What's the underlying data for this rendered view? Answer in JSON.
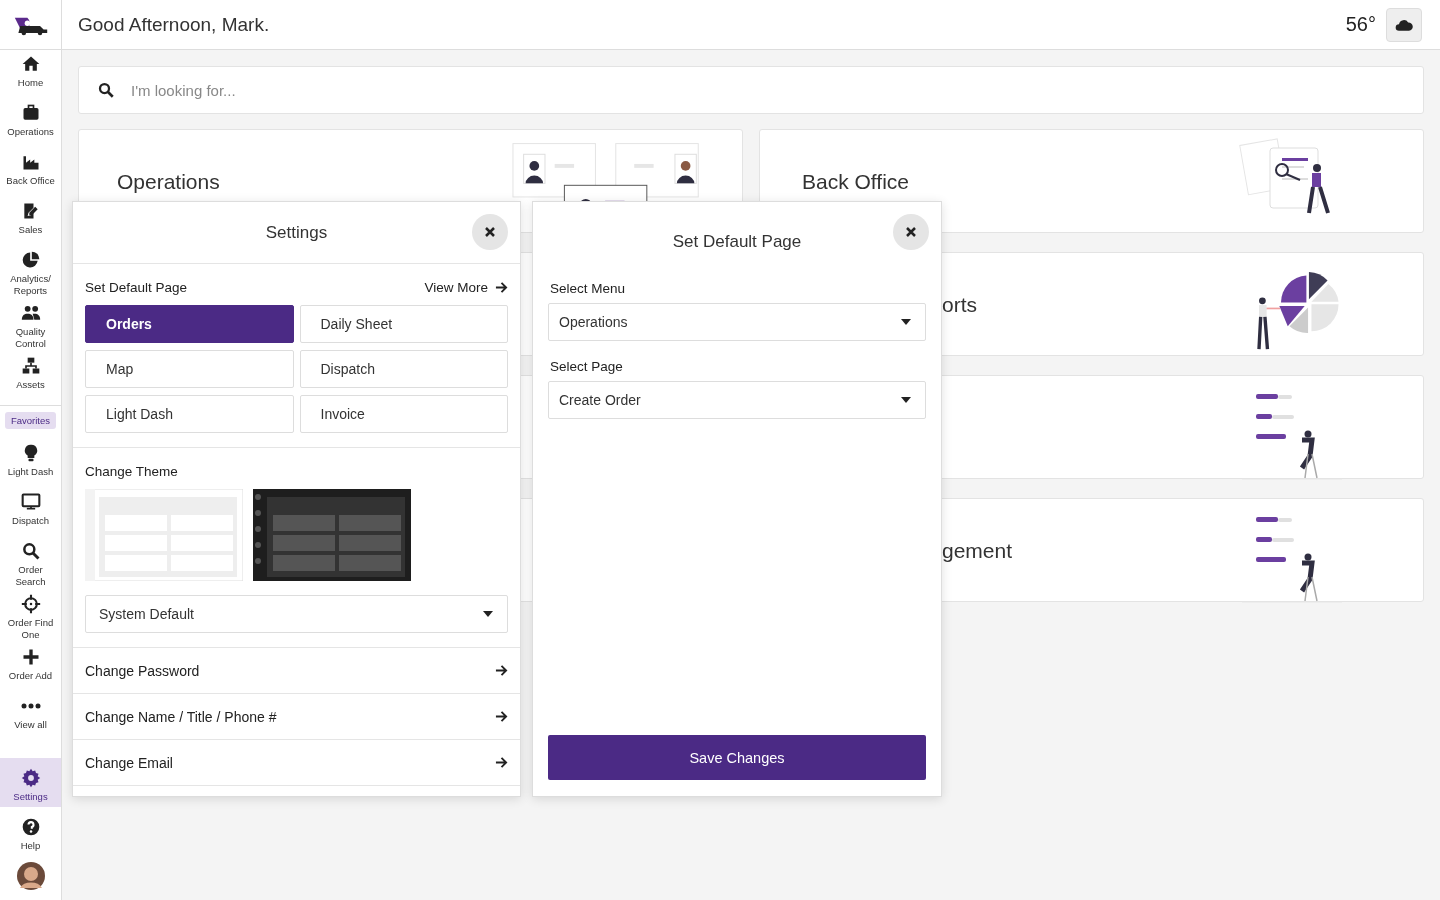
{
  "header": {
    "greeting": "Good Afternoon, Mark.",
    "temperature": "56°"
  },
  "sidebar": {
    "items": [
      {
        "label": "Home"
      },
      {
        "label": "Operations"
      },
      {
        "label": "Back Office"
      },
      {
        "label": "Sales"
      },
      {
        "label": "Analytics/ Reports"
      },
      {
        "label": "Quality Control"
      },
      {
        "label": "Assets"
      }
    ],
    "favorites_label": "Favorites",
    "favorites": [
      {
        "label": "Light Dash"
      },
      {
        "label": "Dispatch"
      },
      {
        "label": "Order Search"
      },
      {
        "label": "Order Find One"
      },
      {
        "label": "Order Add"
      },
      {
        "label": "View all"
      }
    ],
    "bottom": [
      {
        "label": "Settings",
        "selected": true
      },
      {
        "label": "Help",
        "selected": false
      }
    ]
  },
  "search": {
    "placeholder": "I'm looking for..."
  },
  "cards": [
    {
      "title": "Operations",
      "kind": "people"
    },
    {
      "title": "Back Office",
      "kind": "docs"
    },
    {
      "kind": "none"
    },
    {
      "title": "orts",
      "kind": "pie"
    },
    {
      "kind": "none"
    },
    {
      "kind": "bars"
    },
    {
      "kind": "none"
    },
    {
      "title": "gement",
      "kind": "bars"
    }
  ],
  "settings": {
    "title": "Settings",
    "default_page_label": "Set Default Page",
    "view_more": "View More",
    "pages": [
      {
        "label": "Orders",
        "selected": true
      },
      {
        "label": "Daily Sheet",
        "selected": false
      },
      {
        "label": "Map",
        "selected": false
      },
      {
        "label": "Dispatch",
        "selected": false
      },
      {
        "label": "Light Dash",
        "selected": false
      },
      {
        "label": "Invoice",
        "selected": false
      }
    ],
    "theme_label": "Change Theme",
    "themes": [
      {
        "kind": "light"
      },
      {
        "kind": "dark"
      }
    ],
    "theme_value": "System Default",
    "links": [
      "Change Password",
      "Change Name / Title / Phone #",
      "Change Email"
    ]
  },
  "default_page": {
    "title": "Set Default Page",
    "fields": [
      {
        "label": "Select Menu",
        "value": "Operations"
      },
      {
        "label": "Select Page",
        "value": "Create Order"
      }
    ],
    "save": "Save Changes"
  }
}
